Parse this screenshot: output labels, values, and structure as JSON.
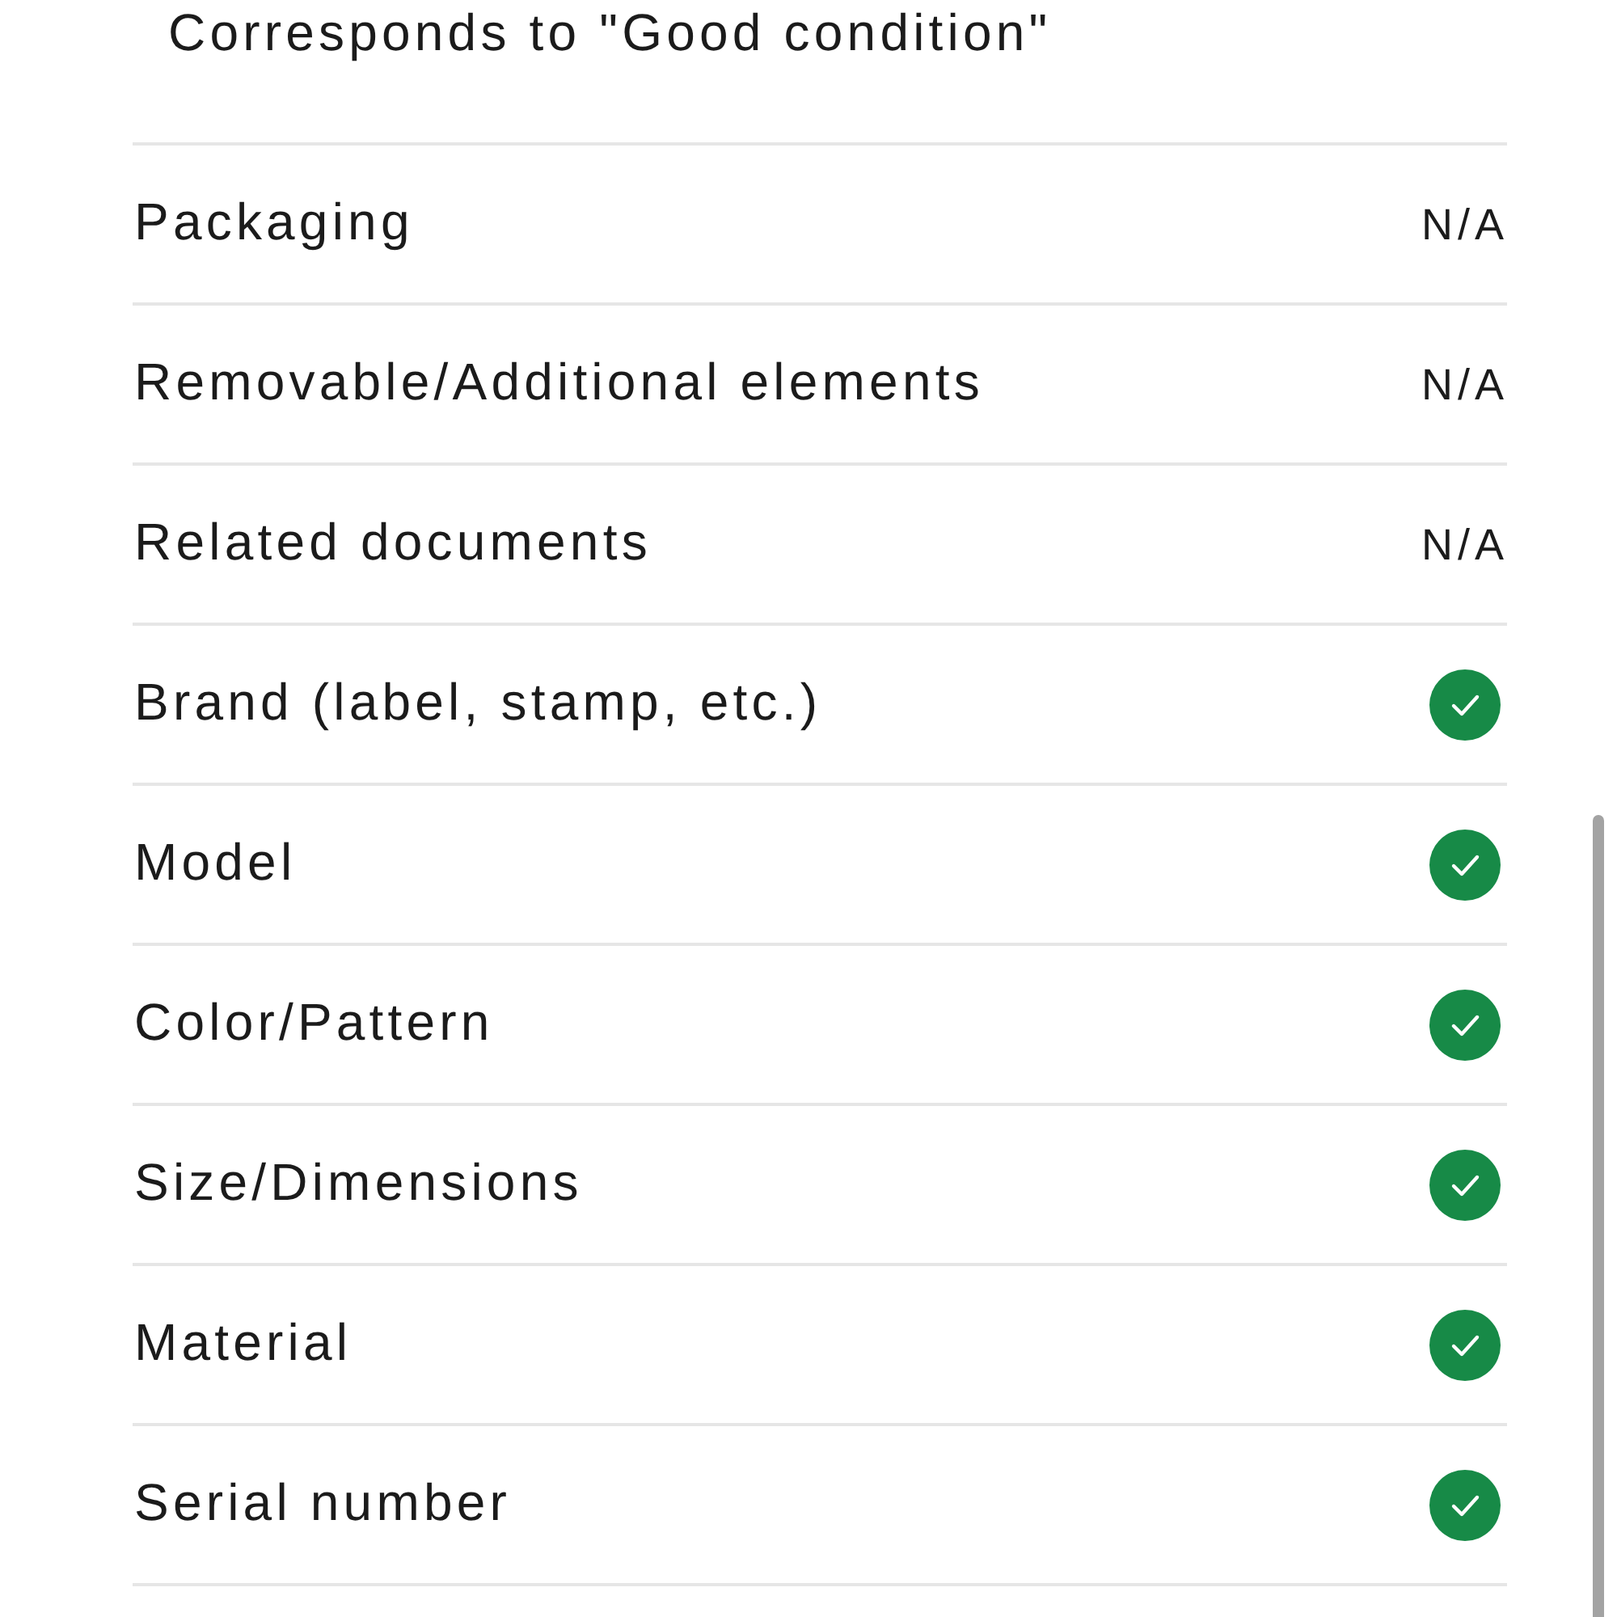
{
  "note": "Corresponds to \"Good condition\"",
  "rows": [
    {
      "label": "Packaging",
      "kind": "value",
      "value": "N/A"
    },
    {
      "label": "Removable/Additional elements",
      "kind": "value",
      "value": "N/A"
    },
    {
      "label": "Related documents",
      "kind": "value",
      "value": "N/A"
    },
    {
      "label": "Brand (label, stamp, etc.)",
      "kind": "check"
    },
    {
      "label": "Model",
      "kind": "check"
    },
    {
      "label": "Color/Pattern",
      "kind": "check"
    },
    {
      "label": "Size/Dimensions",
      "kind": "check"
    },
    {
      "label": "Material",
      "kind": "check"
    },
    {
      "label": "Serial number",
      "kind": "check"
    }
  ]
}
